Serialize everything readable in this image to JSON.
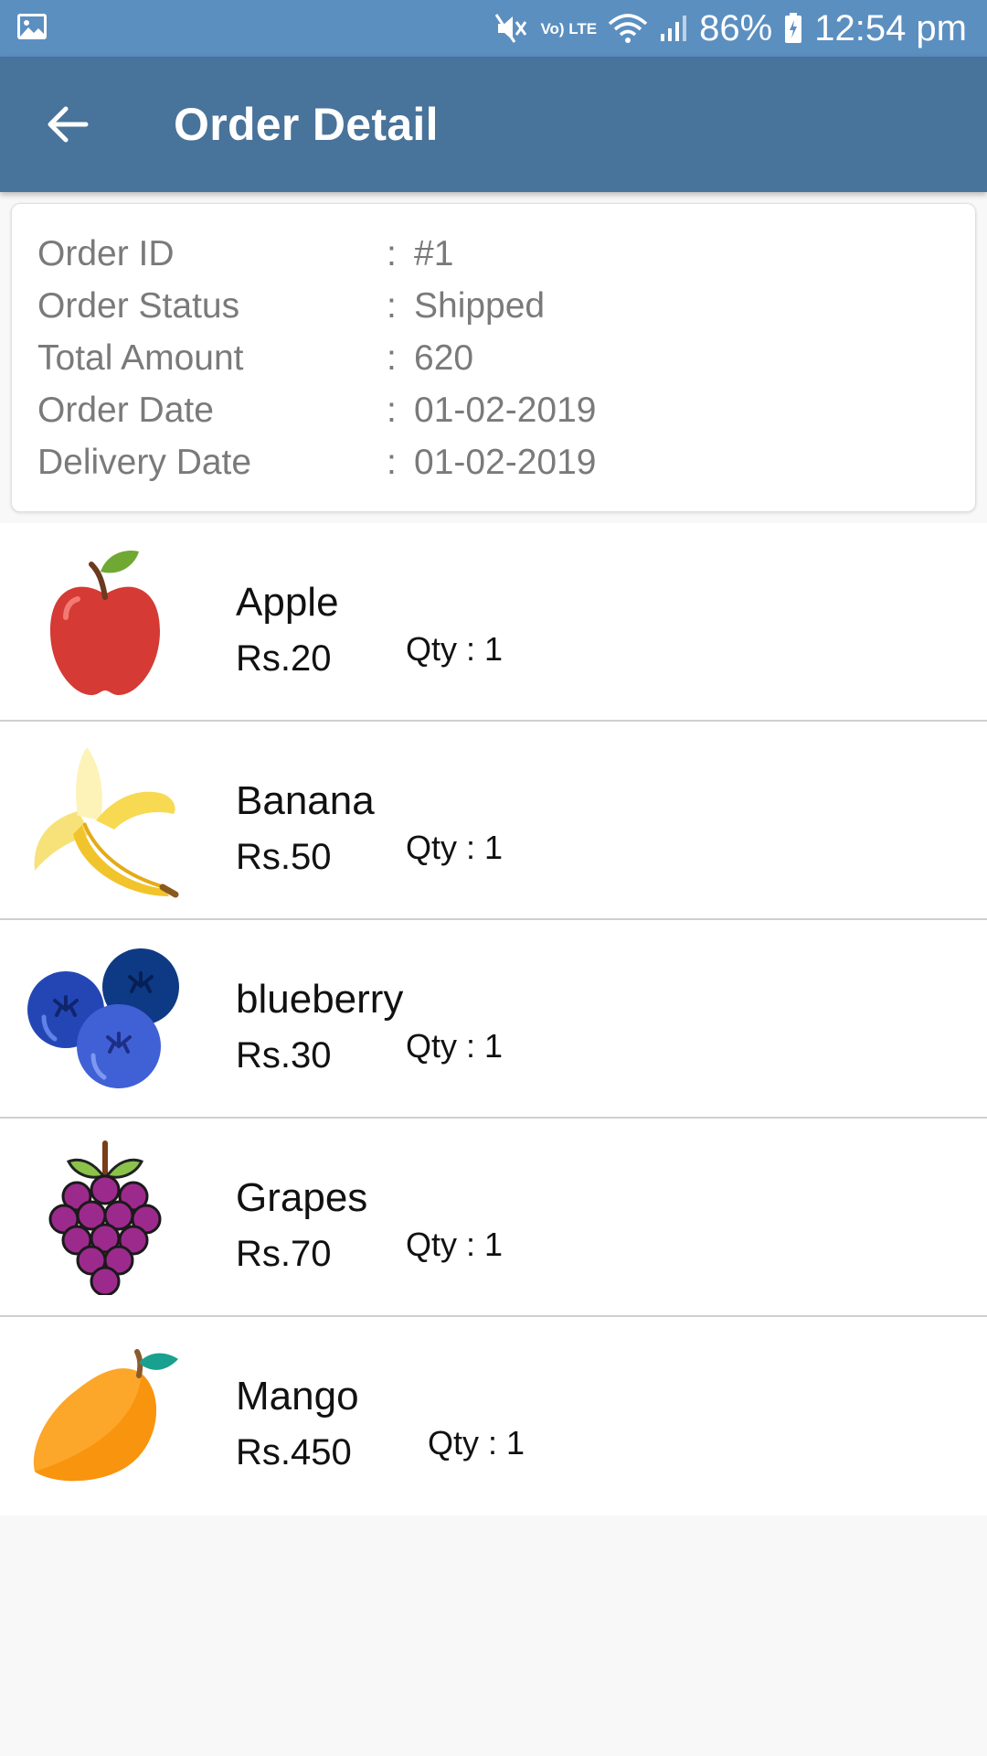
{
  "status_bar": {
    "battery": "86%",
    "time": "12:54 pm",
    "network": "Vo) LTE"
  },
  "app_bar": {
    "title": "Order Detail"
  },
  "order": {
    "rows": [
      {
        "label": "Order ID",
        "value": "#1"
      },
      {
        "label": "Order Status",
        "value": "Shipped"
      },
      {
        "label": "Total Amount",
        "value": "620"
      },
      {
        "label": "Order Date",
        "value": "01-02-2019"
      },
      {
        "label": "Delivery Date",
        "value": "01-02-2019"
      }
    ]
  },
  "items": [
    {
      "name": "Apple",
      "price": "Rs.20",
      "qty": "Qty : 1",
      "icon": "apple-icon"
    },
    {
      "name": "Banana",
      "price": "Rs.50",
      "qty": "Qty : 1",
      "icon": "banana-icon"
    },
    {
      "name": "blueberry",
      "price": "Rs.30",
      "qty": "Qty : 1",
      "icon": "blueberry-icon"
    },
    {
      "name": "Grapes",
      "price": "Rs.70",
      "qty": "Qty : 1",
      "icon": "grapes-icon"
    },
    {
      "name": "Mango",
      "price": "Rs.450",
      "qty": "Qty : 1",
      "icon": "mango-icon"
    }
  ],
  "colors": {
    "status_bar": "#5b8fc0",
    "app_bar": "#48739a",
    "label_text": "#7a7a7a"
  }
}
